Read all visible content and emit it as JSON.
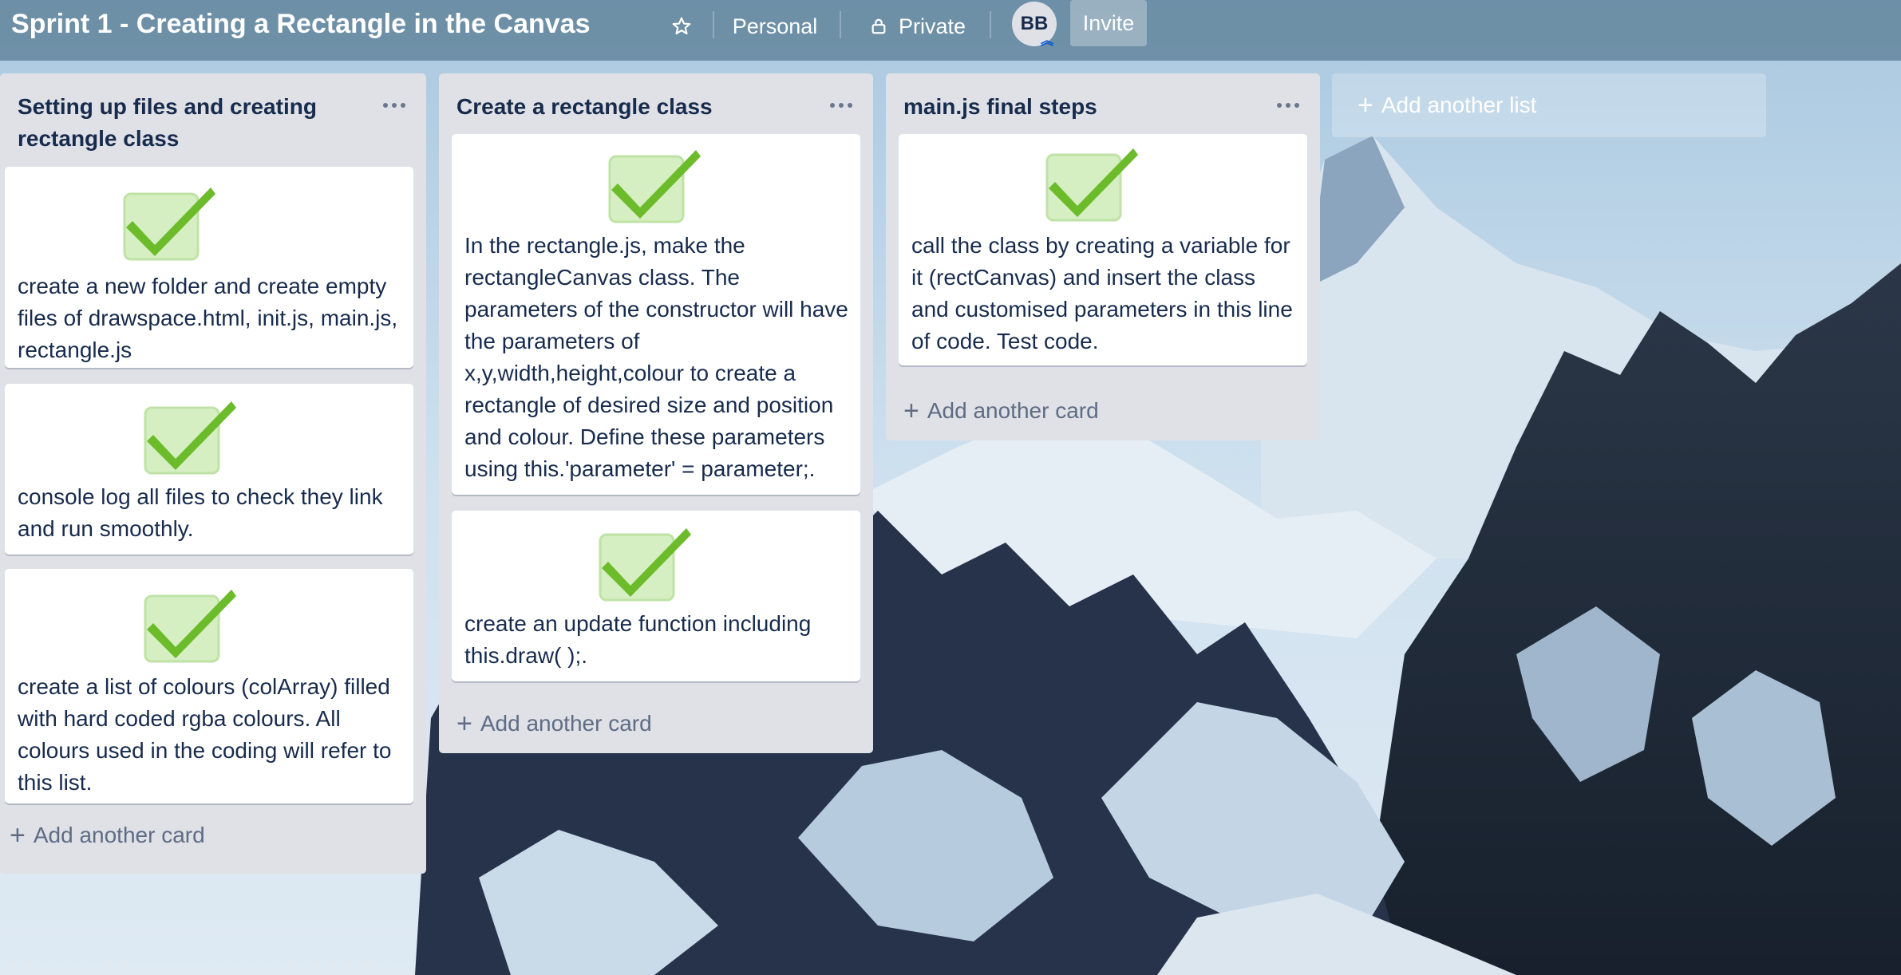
{
  "header": {
    "board_title": "Sprint 1 - Creating a Rectangle in the Canvas",
    "star_icon": "star-icon",
    "visibility_team": "Personal",
    "visibility_privacy": "Private",
    "lock_icon": "lock-icon",
    "avatar_initials": "BB",
    "invite_label": "Invite"
  },
  "lists": [
    {
      "title": "Setting up files and creating rectangle class",
      "cards": [
        {
          "icon": "checkmark-icon",
          "text": "create a new folder and create empty files of drawspace.html, init.js, main.js, rectangle.js"
        },
        {
          "icon": "checkmark-icon",
          "text": "console log all files to check they link and run smoothly."
        },
        {
          "icon": "checkmark-icon",
          "text": "create a list of colours (colArray) filled with hard coded rgba colours. All colours used in the coding will refer to this list."
        }
      ],
      "add_card_label": "Add another card"
    },
    {
      "title": "Create a rectangle class",
      "cards": [
        {
          "icon": "checkmark-icon",
          "text": "In the rectangle.js, make the rectangleCanvas class. The parameters of the constructor will have the parameters of x,y,width,height,colour to create a rectangle of desired size and position and colour. Define these parameters using this.'parameter' = parameter;."
        },
        {
          "icon": "checkmark-icon",
          "text": "create an update function including this.draw( );."
        }
      ],
      "add_card_label": "Add another card"
    },
    {
      "title": "main.js final steps",
      "cards": [
        {
          "icon": "checkmark-icon",
          "text": "call the class by creating a variable for it (rectCanvas) and insert the class and customised parameters in this line of code. Test code."
        }
      ],
      "add_card_label": "Add another card"
    }
  ],
  "add_list_label": "Add another list",
  "colors": {
    "list_bg": "#dfe1e6",
    "card_text": "#172b4d",
    "check_green": "#6cbb2b",
    "check_bg": "#d6efc2"
  }
}
